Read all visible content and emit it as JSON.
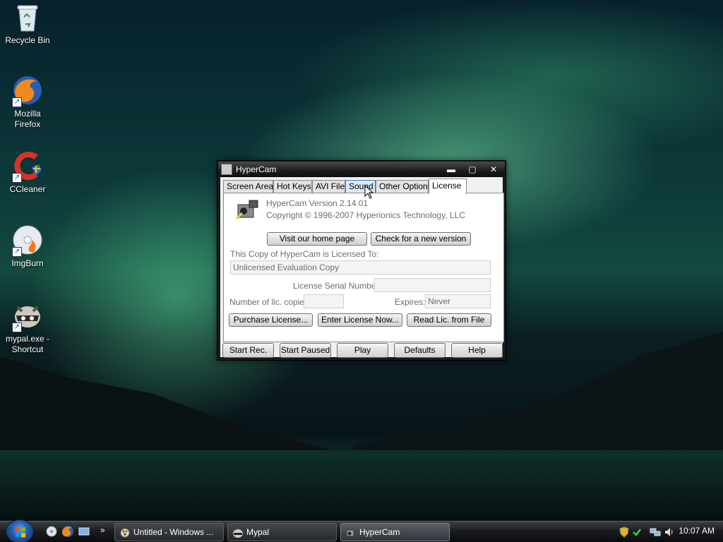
{
  "desktop": {
    "icons": [
      {
        "label": "Recycle Bin",
        "icon": "recycle-bin-icon"
      },
      {
        "label": "Mozilla Firefox",
        "icon": "firefox-icon"
      },
      {
        "label": "CCleaner",
        "icon": "ccleaner-icon"
      },
      {
        "label": "ImgBurn",
        "icon": "imgburn-icon"
      },
      {
        "label": "mypal.exe - Shortcut",
        "icon": "mypal-icon"
      }
    ]
  },
  "window": {
    "title": "HyperCam",
    "controls": {
      "minimize": "▬",
      "maximize": "▢",
      "close": "✕"
    },
    "tabs": [
      "Screen Area",
      "Hot Keys",
      "AVI File",
      "Sound",
      "Other Options",
      "License"
    ],
    "active_tab": "License",
    "license": {
      "version": "HyperCam Version 2.14.01",
      "copyright": "Copyright © 1996-2007 Hyperionics Technology, LLC",
      "visit_btn": "Visit our home page",
      "check_btn": "Check for a new version",
      "licensed_to_label": "This Copy of HyperCam is Licensed To:",
      "licensed_to_value": "Unlicensed Evaluation Copy",
      "serial_label": "License Serial Number:",
      "serial_value": "",
      "copies_label": "Number of lic. copies:",
      "copies_value": "",
      "expires_label": "Expires:",
      "expires_value": "Never",
      "purchase_btn": "Purchase License...",
      "enter_btn": "Enter License Now...",
      "read_btn": "Read Lic. from File"
    },
    "bottom_buttons": [
      "Start Rec.",
      "Start Paused",
      "Play",
      "Defaults",
      "Help"
    ]
  },
  "taskbar": {
    "quick_launch": [
      "show-desktop-icon",
      "firefox-icon",
      "switch-windows-icon"
    ],
    "more": "»",
    "tasks": [
      {
        "label": "Untitled - Windows ...",
        "icon": "paint-icon"
      },
      {
        "label": "Mypal",
        "icon": "mypal-icon"
      },
      {
        "label": "HyperCam",
        "icon": "hypercam-icon"
      }
    ],
    "clock": "10:07 AM"
  }
}
